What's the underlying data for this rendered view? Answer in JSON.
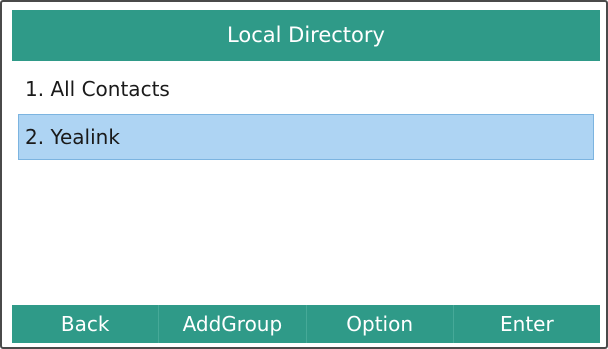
{
  "title": "Local Directory",
  "list": {
    "items": [
      {
        "label": "1. All Contacts"
      },
      {
        "label": "2. Yealink"
      }
    ],
    "selected_index": 1
  },
  "softkeys": [
    {
      "label": "Back"
    },
    {
      "label": "AddGroup"
    },
    {
      "label": "Option"
    },
    {
      "label": "Enter"
    }
  ],
  "colors": {
    "title_bar": "#2f9a88",
    "softkey_bar": "#2f9a88",
    "selection": "#aed4f3"
  }
}
